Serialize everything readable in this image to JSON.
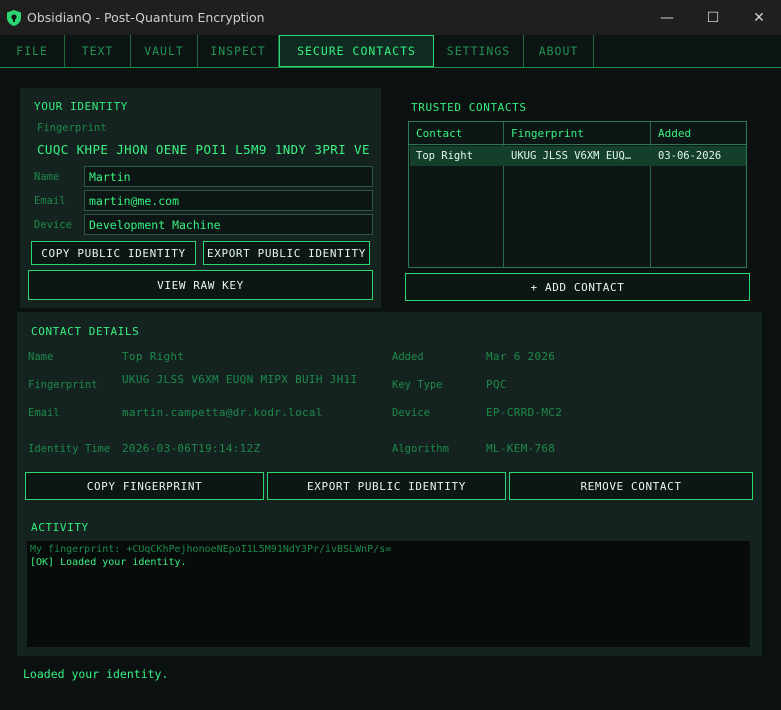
{
  "window": {
    "title": "ObsidianQ - Post-Quantum Encryption",
    "minimize": "—",
    "maximize": "☐",
    "close": "✕"
  },
  "tabs": [
    {
      "label": "FILE"
    },
    {
      "label": "TEXT"
    },
    {
      "label": "VAULT"
    },
    {
      "label": "INSPECT"
    },
    {
      "label": "SECURE CONTACTS",
      "active": true
    },
    {
      "label": "SETTINGS"
    },
    {
      "label": "ABOUT"
    }
  ],
  "identity": {
    "title": "YOUR IDENTITY",
    "fingerprint_label": "Fingerprint",
    "fingerprint": "CUQC KHPE JHON OENE POI1 L5M9 1NDY 3PRI VE",
    "name_label": "Name",
    "name_value": "Martin",
    "email_label": "Email",
    "email_value": "martin@me.com",
    "device_label": "Device",
    "device_value": "Development Machine",
    "copy_button": "COPY PUBLIC IDENTITY",
    "export_button": "EXPORT PUBLIC IDENTITY",
    "view_raw_button": "VIEW RAW KEY"
  },
  "trusted": {
    "title": "TRUSTED CONTACTS",
    "columns": [
      "Contact",
      "Fingerprint",
      "Added"
    ],
    "rows": [
      {
        "contact": "Top Right",
        "fingerprint": "UKUG JLSS V6XM EUQ…",
        "added": "03-06-2026"
      }
    ],
    "add_button": "+ ADD CONTACT"
  },
  "details": {
    "title": "CONTACT DETAILS",
    "name_label": "Name",
    "name_value": "Top Right",
    "fingerprint_label": "Fingerprint",
    "fingerprint_value": "UKUG JLSS V6XM EUQN MIPX BUIH JH1I",
    "email_label": "Email",
    "email_value": "martin.campetta@dr.kodr.local",
    "identity_time_label": "Identity Time",
    "identity_time_value": "2026-03-06T19:14:12Z",
    "added_label": "Added",
    "added_value": "Mar 6 2026",
    "key_type_label": "Key Type",
    "key_type_value": "PQC",
    "device_label": "Device",
    "device_value": "EP-CRRD-MC2",
    "algorithm_label": "Algorithm",
    "algorithm_value": "ML-KEM-768",
    "copy_fp_button": "COPY FINGERPRINT",
    "export_button": "EXPORT PUBLIC IDENTITY",
    "remove_button": "REMOVE CONTACT"
  },
  "activity": {
    "title": "ACTIVITY",
    "lines": [
      "My fingerprint: +CUqCKhPejhonoeNEpoI1L5M91NdY3Pr/ivBSLWnP/s=",
      "[OK] Loaded your identity."
    ]
  },
  "status": {
    "text": "Loaded your identity."
  },
  "colors": {
    "accent": "#2bd673",
    "text": "#38f282",
    "panel": "#142320",
    "background": "#0b1110"
  }
}
